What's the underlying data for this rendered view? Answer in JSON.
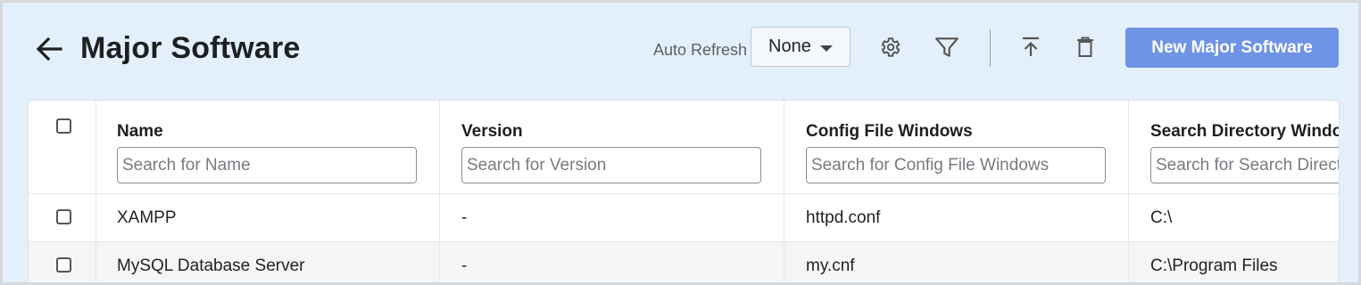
{
  "header": {
    "title": "Major Software",
    "auto_refresh_label": "Auto Refresh",
    "auto_refresh_value": "None",
    "new_button_label": "New Major Software",
    "icons": [
      "back-arrow-icon",
      "settings-gear-icon",
      "filter-icon",
      "upload-icon",
      "delete-trash-icon"
    ]
  },
  "colors": {
    "background": "#e3f0fb",
    "primary_button": "#6f94e6",
    "alt_row": "#f5f5f5"
  },
  "table": {
    "columns": [
      {
        "label": "Name",
        "placeholder": "Search for Name"
      },
      {
        "label": "Version",
        "placeholder": "Search for Version"
      },
      {
        "label": "Config File Windows",
        "placeholder": "Search for Config File Windows"
      },
      {
        "label": "Search Directory Windows",
        "placeholder": "Search for Search Directory Windows"
      }
    ],
    "rows": [
      {
        "name": "XAMPP",
        "version": "-",
        "config": "httpd.conf",
        "search_dir": "C:\\"
      },
      {
        "name": "MySQL Database Server",
        "version": "-",
        "config": "my.cnf",
        "search_dir": "C:\\Program Files"
      }
    ]
  }
}
